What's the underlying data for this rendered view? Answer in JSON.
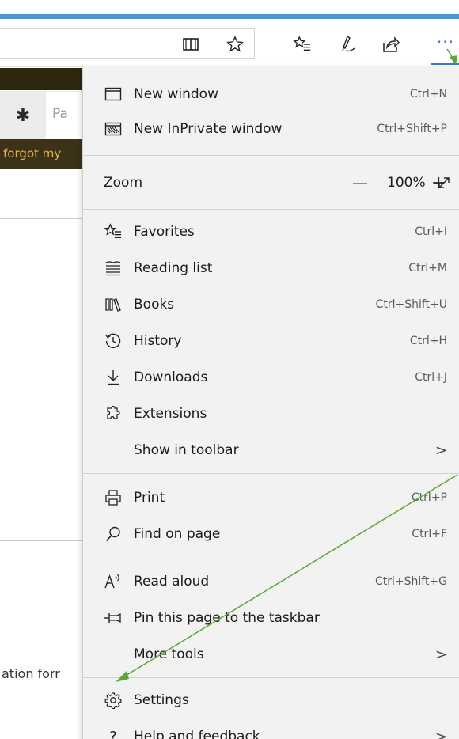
{
  "page": {
    "password_placeholder": "Pa",
    "forgot_text": "forgot my",
    "bottom_snippet": "ation forr"
  },
  "menu": {
    "items_top": [
      {
        "label": "New window",
        "shortcut": "Ctrl+N",
        "icon": "window-icon"
      },
      {
        "label": "New InPrivate window",
        "shortcut": "Ctrl+Shift+P",
        "icon": "inprivate-icon"
      }
    ],
    "zoom": {
      "label": "Zoom",
      "minus": "—",
      "value": "100%",
      "plus": "+",
      "icon": "fullscreen-icon"
    },
    "items_mid": [
      {
        "label": "Favorites",
        "shortcut": "Ctrl+I",
        "icon": "favorites-icon"
      },
      {
        "label": "Reading list",
        "shortcut": "Ctrl+M",
        "icon": "reading-list-icon"
      },
      {
        "label": "Books",
        "shortcut": "Ctrl+Shift+U",
        "icon": "books-icon"
      },
      {
        "label": "History",
        "shortcut": "Ctrl+H",
        "icon": "history-icon"
      },
      {
        "label": "Downloads",
        "shortcut": "Ctrl+J",
        "icon": "download-icon"
      },
      {
        "label": "Extensions",
        "shortcut": "",
        "icon": "extensions-icon"
      },
      {
        "label": "Show in toolbar",
        "chevron": ">",
        "icon": ""
      }
    ],
    "items_tools": [
      {
        "label": "Print",
        "shortcut": "Ctrl+P",
        "icon": "print-icon"
      },
      {
        "label": "Find on page",
        "shortcut": "Ctrl+F",
        "icon": "search-icon"
      },
      {
        "label": "Read aloud",
        "shortcut": "Ctrl+Shift+G",
        "icon": "read-aloud-icon"
      },
      {
        "label": "Pin this page to the taskbar",
        "shortcut": "",
        "icon": "pin-icon"
      },
      {
        "label": "More tools",
        "chevron": ">",
        "icon": ""
      }
    ],
    "items_bottom": [
      {
        "label": "Settings",
        "shortcut": "",
        "icon": "gear-icon"
      },
      {
        "label": "Help and feedback",
        "chevron": ">",
        "icon": "help-icon"
      }
    ]
  },
  "toolbar": {
    "more_label": "···"
  },
  "colors": {
    "accent": "#3a7ad3",
    "annotation_arrow": "#5aa832"
  }
}
